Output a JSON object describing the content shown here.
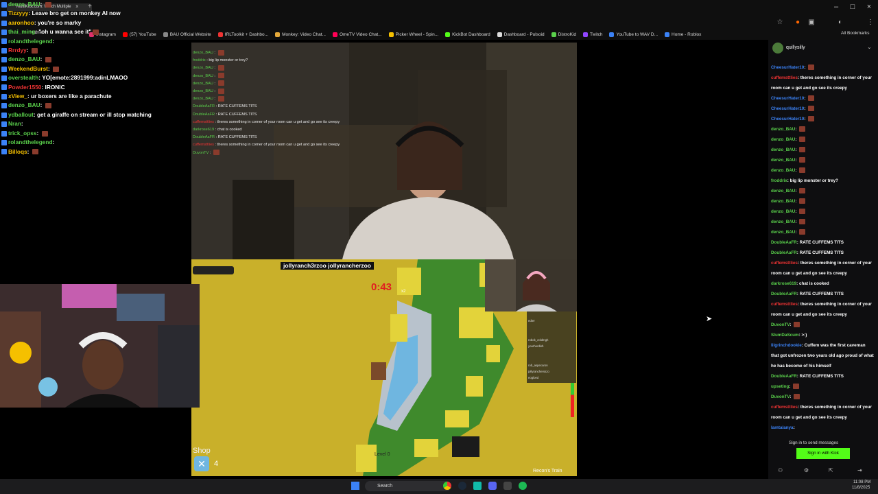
{
  "browser": {
    "tab_label": "MultiKick.com: Watch Multiple",
    "tab_close": "×",
    "new_tab": "+",
    "window_min": "–",
    "window_max": "□",
    "window_close": "×",
    "home_label": "Home",
    "all_bookmarks": "All Bookmarks",
    "bookmarks": [
      {
        "label": "Instagram",
        "color": "#e1306c"
      },
      {
        "label": "(57) YouTube",
        "color": "#ff0000"
      },
      {
        "label": "BAU Official Website",
        "color": "#888888"
      },
      {
        "label": "IRLToolkit + Dashbo...",
        "color": "#e33"
      },
      {
        "label": "Monkey: Video Chat...",
        "color": "#e5a93a"
      },
      {
        "label": "OmeTV Video Chat...",
        "color": "#f05"
      },
      {
        "label": "Picker Wheel - Spin...",
        "color": "#f5c000"
      },
      {
        "label": "KickBot Dashboard",
        "color": "#53fc18"
      },
      {
        "label": "Dashboard - Pulsoid",
        "color": "#ddd"
      },
      {
        "label": "DistroKid",
        "color": "#5ad04b"
      },
      {
        "label": "Twitch",
        "color": "#9146ff"
      },
      {
        "label": "YouTube to WAV D...",
        "color": "#3b82f6"
      },
      {
        "label": "Home - Roblox",
        "color": "#3b82f6"
      }
    ]
  },
  "left_chat": [
    {
      "user": "denzo_BAU",
      "color": "#5ad04b",
      "text": "",
      "emote": true
    },
    {
      "user": "Tizzyyy",
      "color": "#f5c000",
      "text": "Leave bro get on monkey AI now",
      "emote": false
    },
    {
      "user": "aaronhoo",
      "color": "#f5c000",
      "text": "you're so marky",
      "emote": false
    },
    {
      "user": "thai_ming",
      "color": "#5ad04b",
      "text": "\"oh u wanna see it\"",
      "emote": true
    },
    {
      "user": "rolandthelegend",
      "color": "#5ad04b",
      "text": "",
      "emote": false
    },
    {
      "user": "Rrrdyy",
      "color": "#e33",
      "text": "",
      "emote": true
    },
    {
      "user": "denzo_BAU",
      "color": "#5ad04b",
      "text": "",
      "emote": true
    },
    {
      "user": "WeekendBurst",
      "color": "#f5c000",
      "text": "",
      "emote": true
    },
    {
      "user": "overstealth",
      "color": "#5ad04b",
      "text": "YO[emote:2891999:adinLMAOO",
      "emote": false
    },
    {
      "user": "Powder1550",
      "color": "#e33",
      "text": "IRONIC",
      "emote": false
    },
    {
      "user": "xView_",
      "color": "#f5c000",
      "text": "ur boxers are like a parachute",
      "emote": false
    },
    {
      "user": "denzo_BAU",
      "color": "#5ad04b",
      "text": "",
      "emote": true
    },
    {
      "user": "ydballout",
      "color": "#5ad04b",
      "text": "get a giraffe on stream or ill stop watching",
      "emote": false
    },
    {
      "user": "Nran",
      "color": "#5ad04b",
      "text": "",
      "emote": false
    },
    {
      "user": "trick_opss",
      "color": "#5ad04b",
      "text": "",
      "emote": true
    },
    {
      "user": "rolandthelegend",
      "color": "#5ad04b",
      "text": "",
      "emote": false
    },
    {
      "user": "Billoqs",
      "color": "#f5c000",
      "text": "",
      "emote": true
    }
  ],
  "overlay_chat": [
    {
      "user": "denzo_BAU",
      "color": "#5ad04b",
      "text": ""
    },
    {
      "user": "froddrix",
      "color": "#5ad04b",
      "text": "big lip monster or trey?"
    },
    {
      "user": "denzo_BAU",
      "color": "#5ad04b",
      "text": ""
    },
    {
      "user": "denzo_BAU",
      "color": "#5ad04b",
      "text": ""
    },
    {
      "user": "denzo_BAU",
      "color": "#5ad04b",
      "text": ""
    },
    {
      "user": "denzo_BAU",
      "color": "#5ad04b",
      "text": ""
    },
    {
      "user": "denzo_BAU",
      "color": "#5ad04b",
      "text": ""
    },
    {
      "user": "DoubleAaFR",
      "color": "#5ad04b",
      "text": "RATE CUFFEMS TITS"
    },
    {
      "user": "DoubleAaFR",
      "color": "#5ad04b",
      "text": "RATE CUFFEMS TITS"
    },
    {
      "user": "cuffemsttlies",
      "color": "#e33",
      "text": "theres something in corner of your room can u get and go see its creepy"
    },
    {
      "user": "darkrose619",
      "color": "#5ad04b",
      "text": "chat is cooked"
    },
    {
      "user": "DoubleAaFR",
      "color": "#5ad04b",
      "text": "RATE CUFFEMS TITS"
    },
    {
      "user": "cuffemsttlies",
      "color": "#e33",
      "text": "theres something in corner of your room can u get and go see its creepy"
    },
    {
      "user": "DuvonTV",
      "color": "#5ad04b",
      "text": ""
    }
  ],
  "game": {
    "handles": "jollyranch3rzoo  jollyrancherzoo",
    "timer": "0:43",
    "multiplier": "x2",
    "shop_label": "Shop",
    "shop_count": "4",
    "level_label": "Level 0",
    "footer_label": "Recon's Train",
    "player_list": [
      "",
      "edter",
      "",
      "",
      "robok_zoldmgh",
      "yourherdish",
      "",
      "",
      "rob_aspecaron",
      "jollyranchersszo",
      "eogloed"
    ]
  },
  "right_panel": {
    "channel": "quillysilly",
    "chat": [
      {
        "user": "CheesurHater10",
        "color": "#3b82f6",
        "text": "",
        "emote": true
      },
      {
        "user": "cuffemsttlies",
        "color": "#e33",
        "text": "theres something in corner of your room can u get and go see its creepy",
        "emote": false
      },
      {
        "user": "CheesurHater10",
        "color": "#3b82f6",
        "text": "",
        "emote": true
      },
      {
        "user": "CheesurHater10",
        "color": "#3b82f6",
        "text": "",
        "emote": true
      },
      {
        "user": "CheesurHater10",
        "color": "#3b82f6",
        "text": "",
        "emote": true
      },
      {
        "user": "denzo_BAU",
        "color": "#5ad04b",
        "text": "",
        "emote": true
      },
      {
        "user": "denzo_BAU",
        "color": "#5ad04b",
        "text": "",
        "emote": true
      },
      {
        "user": "denzo_BAU",
        "color": "#5ad04b",
        "text": "",
        "emote": true
      },
      {
        "user": "denzo_BAU",
        "color": "#5ad04b",
        "text": "",
        "emote": true
      },
      {
        "user": "denzo_BAU",
        "color": "#5ad04b",
        "text": "",
        "emote": true
      },
      {
        "user": "froddrix",
        "color": "#5ad04b",
        "text": "big lip monster or trey?",
        "emote": false
      },
      {
        "user": "denzo_BAU",
        "color": "#5ad04b",
        "text": "",
        "emote": true
      },
      {
        "user": "denzo_BAU",
        "color": "#5ad04b",
        "text": "",
        "emote": true
      },
      {
        "user": "denzo_BAU",
        "color": "#5ad04b",
        "text": "",
        "emote": true
      },
      {
        "user": "denzo_BAU",
        "color": "#5ad04b",
        "text": "",
        "emote": true
      },
      {
        "user": "denzo_BAU",
        "color": "#5ad04b",
        "text": "",
        "emote": true
      },
      {
        "user": "DoubleAaFR",
        "color": "#5ad04b",
        "text": "RATE CUFFEMS TITS",
        "emote": false
      },
      {
        "user": "DoubleAaFR",
        "color": "#5ad04b",
        "text": "RATE CUFFEMS TITS",
        "emote": false
      },
      {
        "user": "cuffemsttlies",
        "color": "#e33",
        "text": "theres something in corner of your room can u get and go see its creepy",
        "emote": false
      },
      {
        "user": "darkrose619",
        "color": "#5ad04b",
        "text": "chat is cooked",
        "emote": false
      },
      {
        "user": "DoubleAaFR",
        "color": "#5ad04b",
        "text": "RATE CUFFEMS TITS",
        "emote": false
      },
      {
        "user": "cuffemsttlies",
        "color": "#e33",
        "text": "theres something in corner of your room can u get and go see its creepy",
        "emote": false
      },
      {
        "user": "DuvonTV",
        "color": "#5ad04b",
        "text": "",
        "emote": true
      },
      {
        "user": "SlumDaScum",
        "color": "#5ad04b",
        "text": ">:)",
        "emote": false
      },
      {
        "user": "lilgrinchdookie",
        "color": "#3b82f6",
        "text": "Cuffem was the first caveman that got unfrozen two years old ago proud of what he has become of his himself",
        "emote": false
      },
      {
        "user": "DoubleAaFR",
        "color": "#5ad04b",
        "text": "RATE CUFFEMS TITS",
        "emote": false
      },
      {
        "user": "upseting",
        "color": "#5ad04b",
        "text": "",
        "emote": true
      },
      {
        "user": "DuvonTV",
        "color": "#5ad04b",
        "text": "",
        "emote": true
      },
      {
        "user": "cuffemsttlies",
        "color": "#e33",
        "text": "theres something in corner of your room can u get and go see its creepy",
        "emote": false
      },
      {
        "user": "lamtalanya",
        "color": "#3b82f6",
        "text": "",
        "emote": false
      }
    ],
    "signin_prompt": "Sign in to send messages",
    "signin_button": "Sign in with Kick"
  },
  "taskbar": {
    "search_label": "Search",
    "time": "11:08 PM",
    "date": "11/8/2025"
  },
  "colors": {
    "kick_green": "#53fc18",
    "timer_red": "#e02020",
    "game_yellow": "#c9b02a"
  }
}
